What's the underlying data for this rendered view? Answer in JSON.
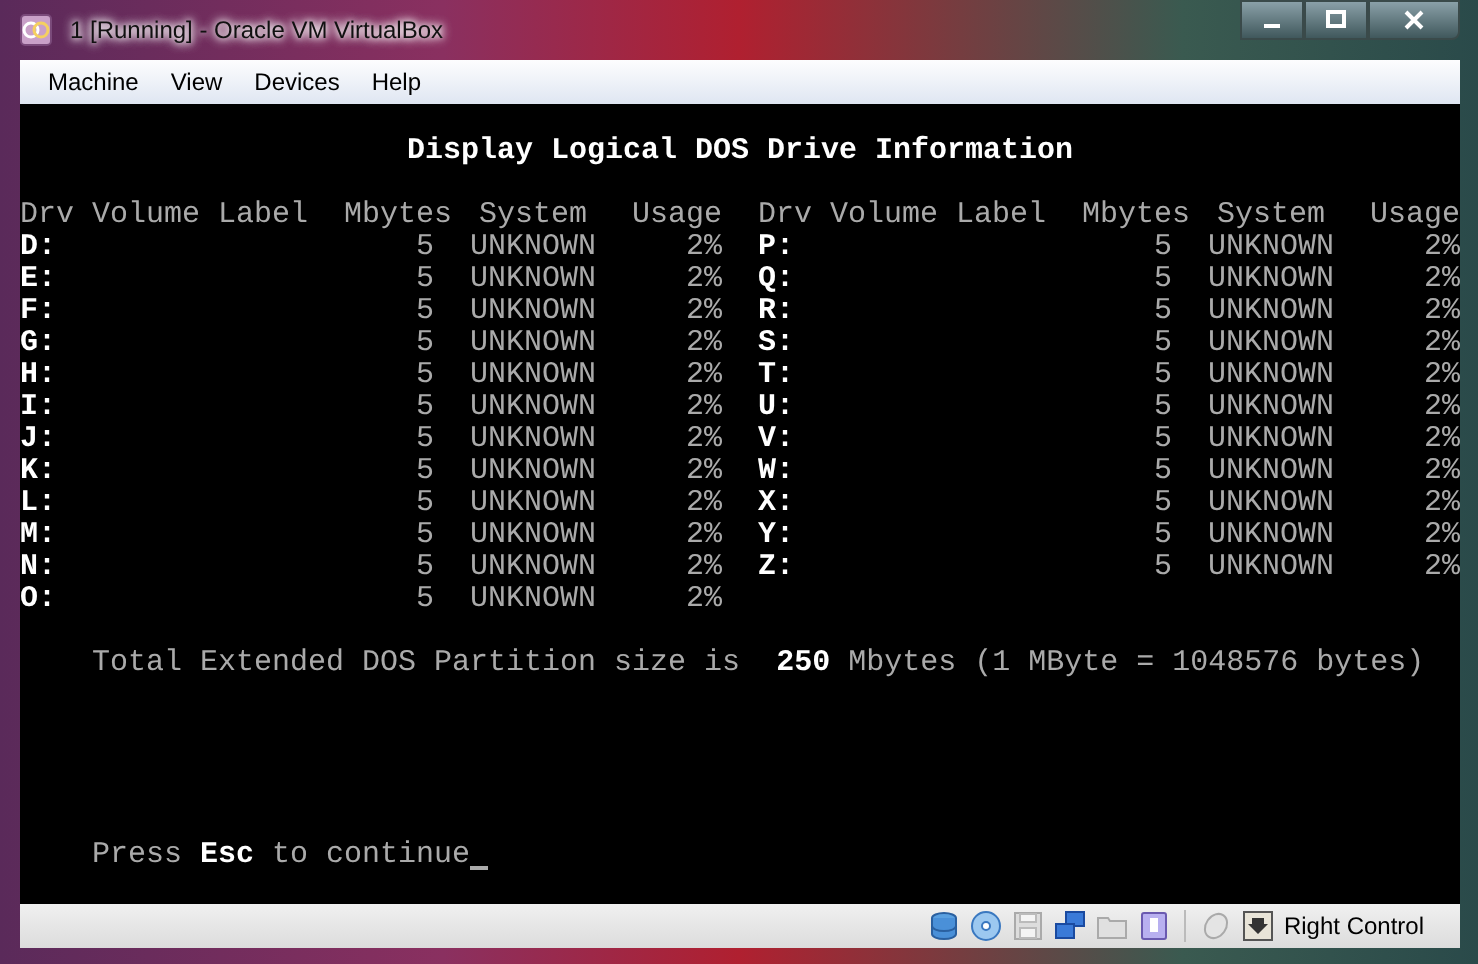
{
  "window": {
    "title": "1 [Running] - Oracle VM VirtualBox"
  },
  "menu": [
    "Machine",
    "View",
    "Devices",
    "Help"
  ],
  "screen": {
    "title": "Display Logical DOS Drive Information",
    "headers": [
      "Drv",
      "Volume Label",
      "Mbytes",
      "System",
      "Usage"
    ],
    "left_rows": [
      {
        "drv": "D:",
        "mbytes": "5",
        "system": "UNKNOWN",
        "usage": "2%"
      },
      {
        "drv": "E:",
        "mbytes": "5",
        "system": "UNKNOWN",
        "usage": "2%"
      },
      {
        "drv": "F:",
        "mbytes": "5",
        "system": "UNKNOWN",
        "usage": "2%"
      },
      {
        "drv": "G:",
        "mbytes": "5",
        "system": "UNKNOWN",
        "usage": "2%"
      },
      {
        "drv": "H:",
        "mbytes": "5",
        "system": "UNKNOWN",
        "usage": "2%"
      },
      {
        "drv": "I:",
        "mbytes": "5",
        "system": "UNKNOWN",
        "usage": "2%"
      },
      {
        "drv": "J:",
        "mbytes": "5",
        "system": "UNKNOWN",
        "usage": "2%"
      },
      {
        "drv": "K:",
        "mbytes": "5",
        "system": "UNKNOWN",
        "usage": "2%"
      },
      {
        "drv": "L:",
        "mbytes": "5",
        "system": "UNKNOWN",
        "usage": "2%"
      },
      {
        "drv": "M:",
        "mbytes": "5",
        "system": "UNKNOWN",
        "usage": "2%"
      },
      {
        "drv": "N:",
        "mbytes": "5",
        "system": "UNKNOWN",
        "usage": "2%"
      },
      {
        "drv": "O:",
        "mbytes": "5",
        "system": "UNKNOWN",
        "usage": "2%"
      }
    ],
    "right_headers": [
      "Drv",
      "Volume Label",
      "Mbytes",
      "System",
      "Usage"
    ],
    "right_rows": [
      {
        "drv": "P:",
        "mbytes": "5",
        "system": "UNKNOWN",
        "usage": "2%"
      },
      {
        "drv": "Q:",
        "mbytes": "5",
        "system": "UNKNOWN",
        "usage": "2%"
      },
      {
        "drv": "R:",
        "mbytes": "5",
        "system": "UNKNOWN",
        "usage": "2%"
      },
      {
        "drv": "S:",
        "mbytes": "5",
        "system": "UNKNOWN",
        "usage": "2%"
      },
      {
        "drv": "T:",
        "mbytes": "5",
        "system": "UNKNOWN",
        "usage": "2%"
      },
      {
        "drv": "U:",
        "mbytes": "5",
        "system": "UNKNOWN",
        "usage": "2%"
      },
      {
        "drv": "V:",
        "mbytes": "5",
        "system": "UNKNOWN",
        "usage": "2%"
      },
      {
        "drv": "W:",
        "mbytes": "5",
        "system": "UNKNOWN",
        "usage": "2%"
      },
      {
        "drv": "X:",
        "mbytes": "5",
        "system": "UNKNOWN",
        "usage": "2%"
      },
      {
        "drv": "Y:",
        "mbytes": "5",
        "system": "UNKNOWN",
        "usage": "2%"
      },
      {
        "drv": "Z:",
        "mbytes": "5",
        "system": "UNKNOWN",
        "usage": "2%"
      }
    ],
    "total": "Total Extended DOS Partition size is  **250** Mbytes (1 MByte = 1048576 bytes)",
    "prompt": "Press **Esc** to continue"
  },
  "status_bar": {
    "host_key": "Right Control"
  }
}
